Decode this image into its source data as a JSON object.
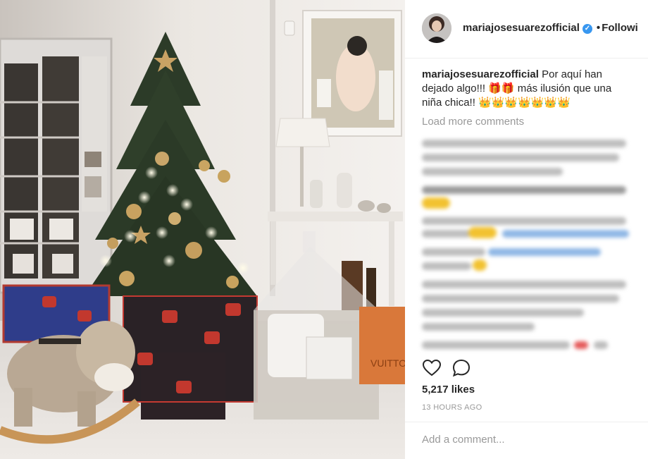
{
  "post": {
    "username": "mariajosesuarezofficial",
    "verified_icon": "✓",
    "separator": "•",
    "follow_label": "Followi",
    "caption_user": "mariajosesuarezofficial",
    "caption_text": "Por aquí han dejado algo!!! 🎁🎁 más ilusión que una niña chica!! 👑👑👑👑👑👑👑",
    "load_more": "Load more comments",
    "likes": "5,217 likes",
    "time_ago": "13 HOURS AGO",
    "comment_placeholder": "Add a comment...",
    "photo_sign": "VUITTO"
  },
  "icons": {
    "like": "heart-icon",
    "comment": "comment-bubble-icon",
    "verified": "verified-badge-icon"
  },
  "colors": {
    "verified_blue": "#3897f0",
    "text_primary": "#262626",
    "text_muted": "#999999"
  }
}
